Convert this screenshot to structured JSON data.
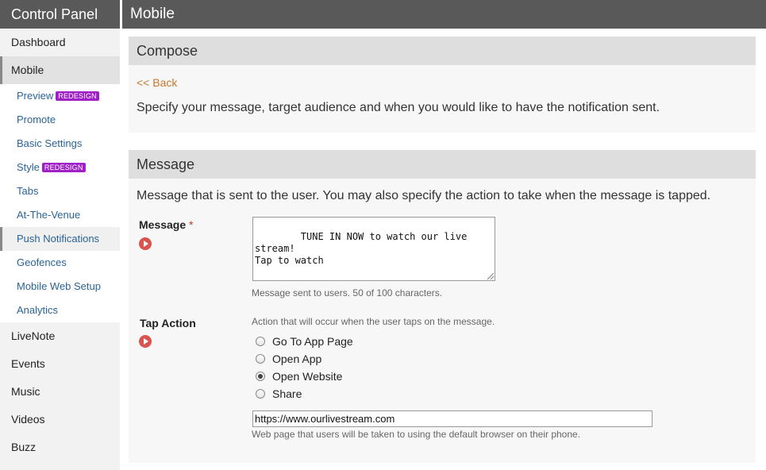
{
  "sidebar": {
    "title": "Control Panel",
    "items_top": [
      {
        "label": "Dashboard"
      },
      {
        "label": "Mobile"
      }
    ],
    "sub_items": [
      {
        "label": "Preview",
        "badge": "REDESIGN"
      },
      {
        "label": "Promote"
      },
      {
        "label": "Basic Settings"
      },
      {
        "label": "Style",
        "badge": "REDESIGN"
      },
      {
        "label": "Tabs"
      },
      {
        "label": "At-The-Venue"
      },
      {
        "label": "Push Notifications"
      },
      {
        "label": "Geofences"
      },
      {
        "label": "Mobile Web Setup"
      },
      {
        "label": "Analytics"
      }
    ],
    "items_bottom": [
      {
        "label": "LiveNote"
      },
      {
        "label": "Events"
      },
      {
        "label": "Music"
      },
      {
        "label": "Videos"
      },
      {
        "label": "Buzz"
      }
    ]
  },
  "header": {
    "title": "Mobile"
  },
  "compose": {
    "title": "Compose",
    "back": "<< Back",
    "description": "Specify your message, target audience and when you would like to have the notification sent."
  },
  "message": {
    "title": "Message",
    "description": "Message that is sent to the user. You may also specify the action to take when the message is tapped.",
    "field_label": "Message",
    "required": "*",
    "value": "TUNE IN NOW to watch our live stream!\nTap to watch",
    "help": "Message sent to users. 50 of 100 characters."
  },
  "tap_action": {
    "label": "Tap Action",
    "help": "Action that will occur when the user taps on the message.",
    "options": [
      {
        "label": "Go To App Page",
        "checked": false
      },
      {
        "label": "Open App",
        "checked": false
      },
      {
        "label": "Open Website",
        "checked": true
      },
      {
        "label": "Share",
        "checked": false
      }
    ],
    "url": "https://www.ourlivestream.com",
    "url_help": "Web page that users will be taken to using the default browser on their phone."
  },
  "colors": {
    "header_bg": "#595959",
    "link": "#2a6496",
    "back_link": "#c8772e",
    "badge": "#a020c8",
    "play_icon": "#d9534f"
  },
  "icons": [
    "play-circle-icon",
    "resize-grip-icon"
  ]
}
